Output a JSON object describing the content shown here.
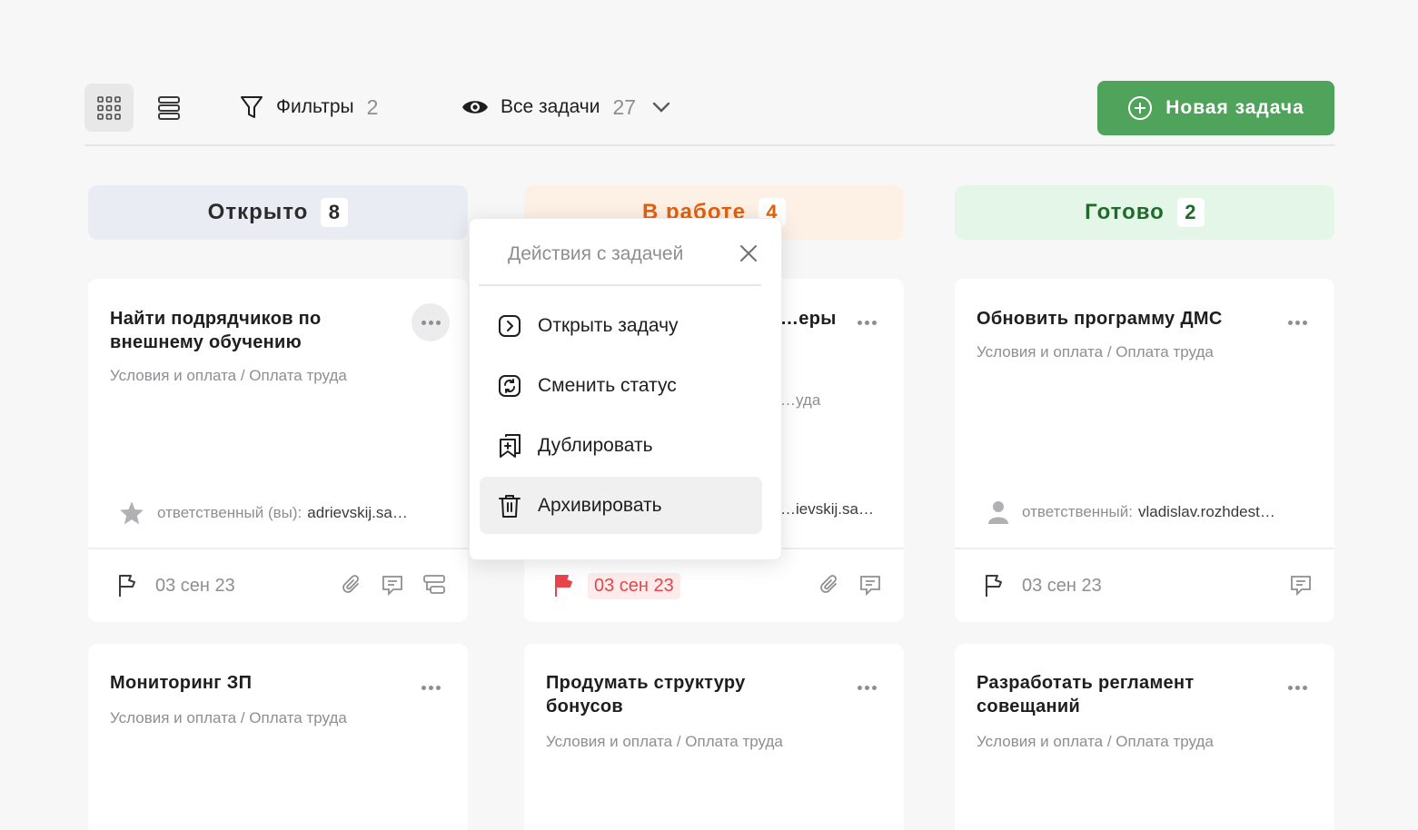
{
  "toolbar": {
    "filters_label": "Фильтры",
    "filters_count": "2",
    "view_label": "Все задачи",
    "view_count": "27",
    "new_task_label": "Новая задача"
  },
  "columns": [
    {
      "title": "Открыто",
      "count": "8",
      "bg": "#e9edf3",
      "color": "#2b2b2b"
    },
    {
      "title": "В работе",
      "count": "4",
      "bg": "#fdf0e4",
      "color": "#e5600c"
    },
    {
      "title": "Готово",
      "count": "2",
      "bg": "#e4f6e8",
      "color": "#1f6b2b"
    }
  ],
  "cards": [
    {
      "title": "Найти подрядчиков по внешнему обучению",
      "category": "Условия и оплата / Оплата труда",
      "assignee_label": "ответственный (вы):",
      "assignee": "adrievskij.sa…",
      "date": "03 сен 23"
    },
    {
      "title": "…еры",
      "category": "…уда",
      "assignee_label": "",
      "assignee": "…ievskij.sa…",
      "date": "03 сен 23"
    },
    {
      "title": "Обновить программу ДМС",
      "category": "Условия и оплата / Оплата труда",
      "assignee_label": "ответственный:",
      "assignee": "vladislav.rozhdest…",
      "date": "03 сен 23"
    },
    {
      "title": "Мониторинг ЗП",
      "category": "Условия и оплата / Оплата труда"
    },
    {
      "title": "Продумать структуру бонусов",
      "category": "Условия и оплата / Оплата труда"
    },
    {
      "title": "Разработать регламент совещаний",
      "category": "Условия и оплата / Оплата труда"
    }
  ],
  "popup": {
    "title": "Действия с задачей",
    "items": [
      {
        "label": "Открыть задачу",
        "icon": "open-task-icon"
      },
      {
        "label": "Сменить статус",
        "icon": "change-status-icon"
      },
      {
        "label": "Дублировать",
        "icon": "duplicate-icon"
      },
      {
        "label": "Архивировать",
        "icon": "trash-icon"
      }
    ]
  },
  "colors": {
    "accent": "#4fa35a",
    "overdue": "#e8444a",
    "muted": "#8e8e93"
  }
}
